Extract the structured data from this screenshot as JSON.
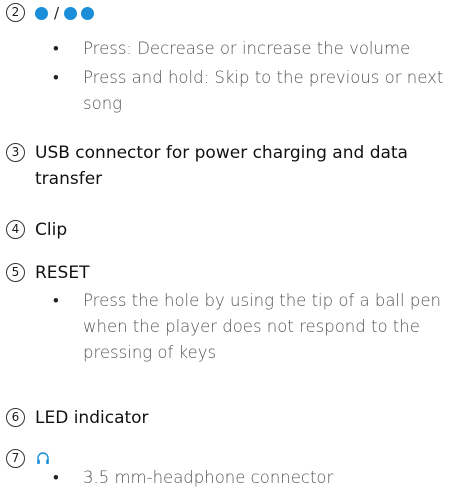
{
  "items": [
    {
      "number": "2",
      "icons": [
        "volume-down-dot",
        "volume-up-dot"
      ],
      "separator": "/",
      "bullets": [
        {
          "text": "Press: Decrease or increase the volume"
        },
        {
          "text": "Press and hold: Skip to the previous or next song"
        }
      ]
    },
    {
      "number": "3",
      "title": "USB connector for power charging and data transfer"
    },
    {
      "number": "4",
      "title": "Clip"
    },
    {
      "number": "5",
      "title": "RESET",
      "bullets": [
        {
          "text": "Press the hole by using the tip of a ball pen when the player does not respond to the pressing of keys"
        }
      ]
    },
    {
      "number": "6",
      "title": "LED indicator"
    },
    {
      "number": "7",
      "icon": "headphone-icon",
      "bullets": [
        {
          "text": "3.5 mm-headphone connector"
        }
      ]
    }
  ],
  "bullet_char": "•",
  "colors": {
    "accent": "#1a8fd8",
    "text": "#111111",
    "body_text": "#555555"
  }
}
